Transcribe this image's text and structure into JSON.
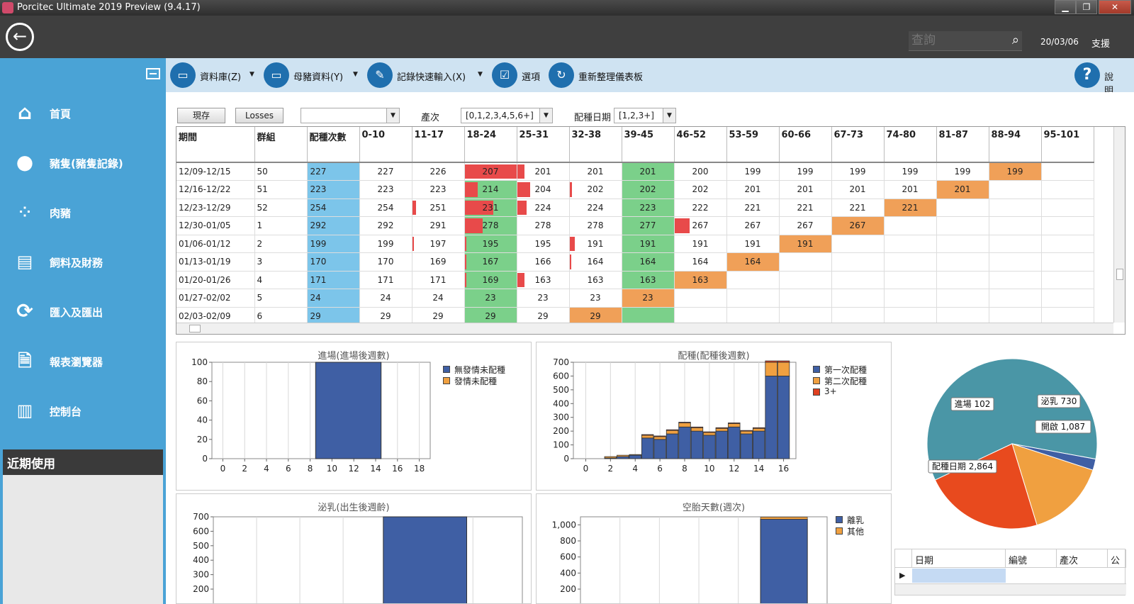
{
  "window": {
    "title": "Porcitec Ultimate 2019 Preview (9.4.17)"
  },
  "header": {
    "search_placeholder": "查詢",
    "date": "20/03/06",
    "support": "支援"
  },
  "sidebar": {
    "items": [
      {
        "label": "首頁",
        "icon": "home-icon"
      },
      {
        "label": "豬隻(豬隻記錄)",
        "icon": "pig-icon"
      },
      {
        "label": "肉豬",
        "icon": "grid-dots-icon"
      },
      {
        "label": "飼料及財務",
        "icon": "cash-register-icon"
      },
      {
        "label": "匯入及匯出",
        "icon": "sync-icon"
      },
      {
        "label": "報表瀏覽器",
        "icon": "report-icon"
      },
      {
        "label": "控制台",
        "icon": "console-icon"
      }
    ],
    "recent": "近期使用"
  },
  "toolbar": {
    "database": "資料庫(Z)",
    "sow_data": "母豬資料(Y)",
    "quick_entry": "記錄快速輸入(X)",
    "options": "選項",
    "refresh": "重新整理儀表板",
    "help": "說明"
  },
  "filter": {
    "current": "現存",
    "losses": "Losses",
    "parity_label": "產次",
    "parity_value": "[0,1,2,3,4,5,6+]",
    "breed_date_label": "配種日期",
    "breed_date_value": "[1,2,3+]"
  },
  "grid": {
    "columns": [
      "期間",
      "群組",
      "配種次數",
      "0-10",
      "11-17",
      "18-24",
      "25-31",
      "32-38",
      "39-45",
      "46-52",
      "53-59",
      "60-66",
      "67-73",
      "74-80",
      "81-87",
      "88-94",
      "95-101"
    ],
    "rows": [
      {
        "cells": [
          "12/09-12/15",
          "50",
          "227",
          "227",
          "226",
          "207",
          "201",
          "201",
          "201",
          "200",
          "199",
          "199",
          "199",
          "199",
          "199",
          "199",
          ""
        ],
        "orange": 15,
        "green": [
          8
        ],
        "red": {
          "5": 1.0,
          "6": 0.15
        }
      },
      {
        "cells": [
          "12/16-12/22",
          "51",
          "223",
          "223",
          "223",
          "214",
          "204",
          "202",
          "202",
          "202",
          "201",
          "201",
          "201",
          "201",
          "201",
          "",
          ""
        ],
        "orange": 14,
        "green": [
          5,
          8
        ],
        "red": {
          "5": 0.25,
          "6": 0.25,
          "7": 0.05
        }
      },
      {
        "cells": [
          "12/23-12/29",
          "52",
          "254",
          "254",
          "251",
          "231",
          "224",
          "224",
          "223",
          "222",
          "221",
          "221",
          "221",
          "221",
          "",
          "",
          ""
        ],
        "orange": 13,
        "green": [
          5,
          8
        ],
        "red": {
          "4": 0.08,
          "5": 0.55,
          "6": 0.18
        }
      },
      {
        "cells": [
          "12/30-01/05",
          "1",
          "292",
          "292",
          "291",
          "278",
          "278",
          "278",
          "277",
          "267",
          "267",
          "267",
          "267",
          "",
          "",
          "",
          ""
        ],
        "orange": 12,
        "green": [
          5,
          8
        ],
        "red": {
          "5": 0.35,
          "9": 0.3
        }
      },
      {
        "cells": [
          "01/06-01/12",
          "2",
          "199",
          "199",
          "197",
          "195",
          "195",
          "191",
          "191",
          "191",
          "191",
          "191",
          "",
          "",
          "",
          "",
          ""
        ],
        "orange": 11,
        "green": [
          5,
          8
        ],
        "red": {
          "4": 0.04,
          "5": 0.03,
          "7": 0.1
        }
      },
      {
        "cells": [
          "01/13-01/19",
          "3",
          "170",
          "170",
          "169",
          "167",
          "166",
          "164",
          "164",
          "164",
          "164",
          "",
          "",
          "",
          "",
          "",
          ""
        ],
        "orange": 10,
        "green": [
          5,
          8
        ],
        "red": {
          "5": 0.03,
          "7": 0.03
        }
      },
      {
        "cells": [
          "01/20-01/26",
          "4",
          "171",
          "171",
          "171",
          "169",
          "163",
          "163",
          "163",
          "163",
          "",
          "",
          "",
          "",
          "",
          "",
          ""
        ],
        "orange": 9,
        "green": [
          5,
          8
        ],
        "red": {
          "5": 0.03,
          "6": 0.15
        }
      },
      {
        "cells": [
          "01/27-02/02",
          "5",
          "24",
          "24",
          "24",
          "23",
          "23",
          "23",
          "23",
          "",
          "",
          "",
          "",
          "",
          "",
          "",
          ""
        ],
        "orange": 8,
        "green": [
          5
        ],
        "red": {}
      },
      {
        "cells": [
          "02/03-02/09",
          "6",
          "29",
          "29",
          "29",
          "29",
          "29",
          "29",
          "",
          "",
          "",
          "",
          "",
          "",
          "",
          "",
          ""
        ],
        "orange": 7,
        "green": [
          5,
          8
        ],
        "red": {}
      }
    ]
  },
  "chart_data": [
    {
      "type": "bar",
      "title": "進場(進場後週數)",
      "x": [
        0,
        2,
        4,
        6,
        8,
        10,
        12,
        14,
        16,
        18
      ],
      "ylim": [
        0,
        100
      ],
      "yticks": [
        0,
        20,
        40,
        60,
        80,
        100
      ],
      "series": [
        {
          "name": "無發情未配種",
          "color": "#3f5fa4",
          "bars": [
            {
              "x0": 8.5,
              "x1": 14.5,
              "value": 100
            }
          ]
        },
        {
          "name": "發情未配種",
          "color": "#f0a040",
          "bars": []
        }
      ]
    },
    {
      "type": "bar",
      "title": "配種(配種後週數)",
      "x": [
        0,
        2,
        4,
        6,
        8,
        10,
        12,
        14,
        16
      ],
      "ylim": [
        0,
        700
      ],
      "yticks": [
        0,
        100,
        200,
        300,
        400,
        500,
        600,
        700
      ],
      "categories": [
        2,
        3,
        4,
        5,
        6,
        7,
        8,
        9,
        10,
        11,
        12,
        13,
        14,
        15,
        16
      ],
      "series": [
        {
          "name": "第一次配種",
          "color": "#3f5fa4",
          "values": [
            5,
            15,
            25,
            150,
            140,
            180,
            230,
            200,
            170,
            200,
            230,
            180,
            200,
            600,
            600
          ]
        },
        {
          "name": "第二次配種",
          "color": "#f0a040",
          "values": [
            10,
            10,
            5,
            20,
            20,
            25,
            30,
            25,
            20,
            20,
            25,
            20,
            20,
            100,
            100
          ]
        },
        {
          "name": "3+",
          "color": "#e04020",
          "values": [
            0,
            0,
            0,
            5,
            5,
            5,
            5,
            5,
            5,
            5,
            5,
            5,
            5,
            10,
            10
          ]
        }
      ]
    },
    {
      "type": "pie",
      "slices": [
        {
          "label": "配種日期 2,864",
          "value": 2864,
          "color": "#4a96a6"
        },
        {
          "label": "開啟 1,087",
          "value": 1087,
          "color": "#e84a1e"
        },
        {
          "label": "泌乳 730",
          "value": 730,
          "color": "#f0a040"
        },
        {
          "label": "進場 102",
          "value": 102,
          "color": "#3f5fa4"
        }
      ]
    },
    {
      "type": "bar",
      "title": "泌乳(出生後週齡)",
      "ylim": [
        200,
        700
      ],
      "yticks": [
        200,
        300,
        400,
        500,
        600,
        700
      ],
      "series": [
        {
          "color": "#3f5fa4",
          "bars": [
            {
              "x0": 0.55,
              "x1": 0.82,
              "value": 700
            }
          ]
        }
      ]
    },
    {
      "type": "bar",
      "title": "空胎天數(週次)",
      "ylim": [
        200,
        1100
      ],
      "yticks": [
        200,
        400,
        600,
        800,
        1000
      ],
      "ytick_labels": [
        "200",
        "400",
        "600",
        "800",
        "1,000"
      ],
      "series": [
        {
          "name": "離乳",
          "color": "#3f5fa4",
          "bars": [
            {
              "x0": 0.73,
              "x1": 0.92,
              "value": 1070
            }
          ]
        },
        {
          "name": "其他",
          "color": "#f0a040",
          "bars": []
        }
      ]
    }
  ],
  "lower_table": {
    "columns": [
      "日期",
      "編號",
      "產次",
      "公"
    ]
  }
}
